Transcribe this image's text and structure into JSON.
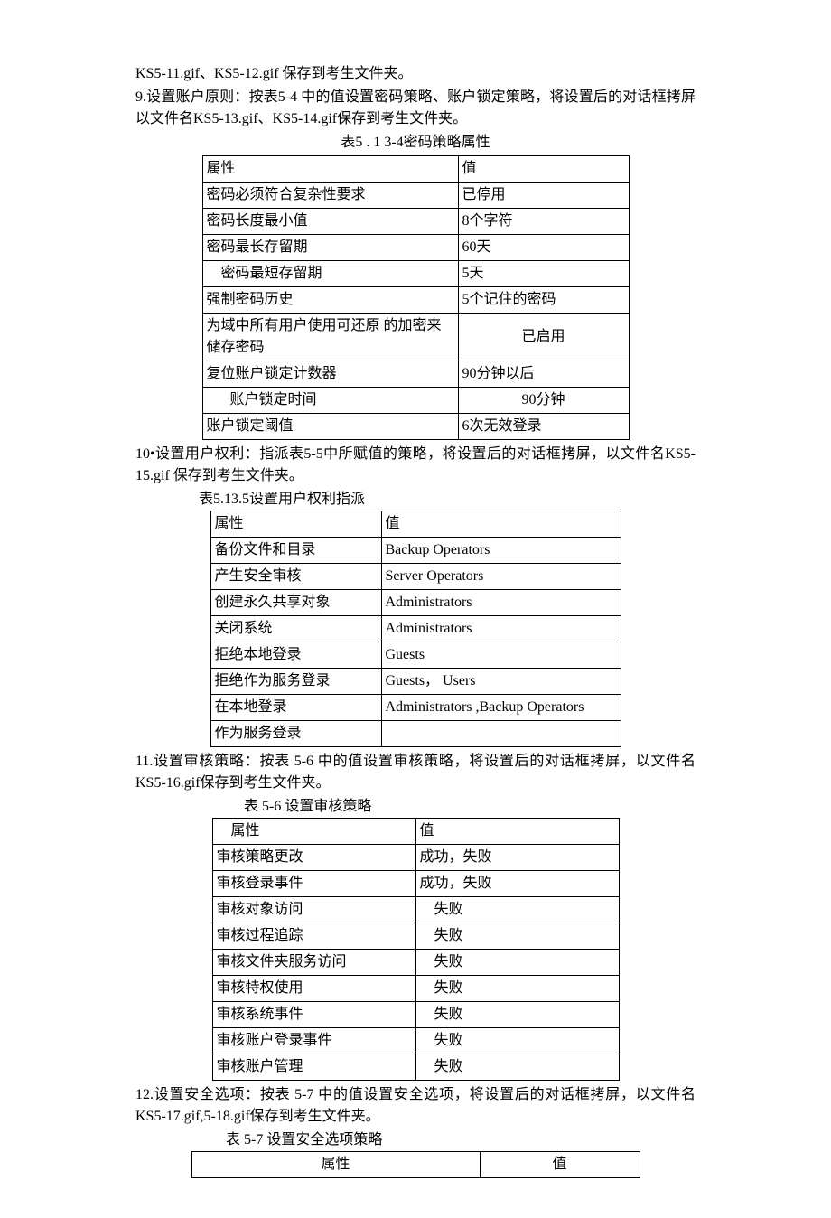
{
  "intro": {
    "p1": "KS5-11.gif、KS5-12.gif 保存到考生文件夹。",
    "p2": "9.设置账户原则：按表5-4 中的值设置密码策略、账户锁定策略，将设置后的对话框拷屏以文件名KS5-13.gif、KS5-14.gif保存到考生文件夹。"
  },
  "table1": {
    "caption": "表5 . 1 3-4密码策略属性",
    "header": {
      "c1": "属性",
      "c2": "值"
    },
    "rows": [
      {
        "c1": "密码必须符合复杂性要求",
        "c2": "已停用"
      },
      {
        "c1": "密码长度最小值",
        "c2": "8个字符"
      },
      {
        "c1": "密码最长存留期",
        "c2": "60天"
      },
      {
        "c1": "密码最短存留期",
        "c2": "5天",
        "indent": 1
      },
      {
        "c1": "强制密码历史",
        "c2": "5个记住的密码"
      },
      {
        "c1": "为域中所有用户使用可还原  的加密来储存密码",
        "c2": "已启用",
        "c2center": true
      },
      {
        "c1": "复位账户锁定计数器",
        "c2": "90分钟以后"
      },
      {
        "c1": "账户锁定时间",
        "c2": "90分钟",
        "indent": 2,
        "c2center": true
      },
      {
        "c1": "账户锁定阈值",
        "c2": "6次无效登录"
      }
    ]
  },
  "para10": "10•设置用户权利：指派表5-5中所赋值的策略，将设置后的对话框拷屏，以文件名KS5-15.gif 保存到考生文件夹。",
  "table2": {
    "caption": "表5.13.5设置用户权利指派",
    "header": {
      "c1": "属性",
      "c2": "值"
    },
    "rows": [
      {
        "c1": "备份文件和目录",
        "c2": "Backup Operators"
      },
      {
        "c1": "产生安全审核",
        "c2": "Server Operators"
      },
      {
        "c1": "创建永久共享对象",
        "c2": "Administrators"
      },
      {
        "c1": "关闭系统",
        "c2": "Administrators"
      },
      {
        "c1": "拒绝本地登录",
        "c2": "Guests"
      },
      {
        "c1": "拒绝作为服务登录",
        "c2": "Guests， Users"
      },
      {
        "c1": "在本地登录",
        "c2": "Administrators ,Backup Operators"
      },
      {
        "c1": "作为服务登录",
        "c2": ""
      }
    ]
  },
  "para11": "11.设置审核策略：按表  5-6 中的值设置审核策略，将设置后的对话框拷屏，以文件名  KS5-16.gif保存到考生文件夹。",
  "table3": {
    "caption": "表  5-6 设置审核策略",
    "header": {
      "c1": "属性",
      "c2": "值",
      "c1indent": true
    },
    "rows": [
      {
        "c1": "审核策略更改",
        "c2": "成功，失败"
      },
      {
        "c1": "审核登录事件",
        "c2": "成功，失败"
      },
      {
        "c1": "审核对象访问",
        "c2": "失败",
        "c2indent": true
      },
      {
        "c1": "审核过程追踪",
        "c2": "失败",
        "c2indent": true
      },
      {
        "c1": "审核文件夹服务访问",
        "c2": "失败",
        "c2indent": true
      },
      {
        "c1": "审核特权使用",
        "c2": "失败",
        "c2indent": true
      },
      {
        "c1": "审核系统事件",
        "c2": "失败",
        "c2indent": true
      },
      {
        "c1": "审核账户登录事件",
        "c2": "失败",
        "c2indent": true
      },
      {
        "c1": "审核账户管理",
        "c2": "失败",
        "c2indent": true
      }
    ]
  },
  "para12": "12.设置安全选项：按表  5-7 中的值设置安全选项，将设置后的对话框拷屏，以文件名KS5-17.gif,5-18.gif保存到考生文件夹。",
  "table4": {
    "caption": "表  5-7 设置安全选项策略",
    "header": {
      "c1": "属性",
      "c2": "值"
    }
  }
}
